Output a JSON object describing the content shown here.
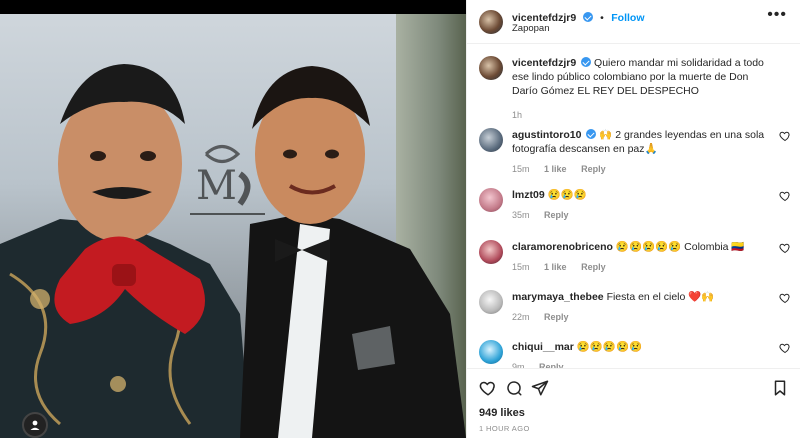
{
  "post": {
    "username": "vicentefdzjr9",
    "follow_label": "Follow",
    "location": "Zapopan",
    "caption": "Quiero mandar mi solidaridad a todo ese lindo público colombiano por la muerte de Don Darío Gómez EL REY DEL DESPECHO",
    "caption_time": "1h",
    "likes": "949 likes",
    "timestamp": "1 HOUR AGO"
  },
  "comments": [
    {
      "username": "agustintoro10",
      "verified": true,
      "text": "🙌 2 grandes leyendas en una sola fotografía descansen en paz🙏",
      "time": "15m",
      "likes": "1 like",
      "reply": "Reply"
    },
    {
      "username": "lmzt09",
      "verified": false,
      "text": "😢😢😢",
      "time": "35m",
      "likes": "",
      "reply": "Reply"
    },
    {
      "username": "claramorenobriceno",
      "verified": false,
      "text": "😢😢😢😢😢 Colombia 🇨🇴",
      "time": "15m",
      "likes": "1 like",
      "reply": "Reply"
    },
    {
      "username": "marymaya_thebee",
      "verified": false,
      "text": "Fiesta en el cielo ❤️🙌",
      "time": "22m",
      "likes": "",
      "reply": "Reply"
    },
    {
      "username": "chiqui__mar",
      "verified": false,
      "text": "😢😢😢😢😢",
      "time": "9m",
      "likes": "",
      "reply": "Reply"
    }
  ],
  "icons": {
    "verified": "verified-badge-icon",
    "more": "more-options-icon",
    "like": "heart-icon",
    "comment": "comment-icon",
    "share": "send-icon",
    "save": "bookmark-icon"
  },
  "colors": {
    "link_blue": "#0095f6",
    "verified_blue": "#3897f0",
    "muted": "#8e8e8e",
    "text": "#262626"
  }
}
